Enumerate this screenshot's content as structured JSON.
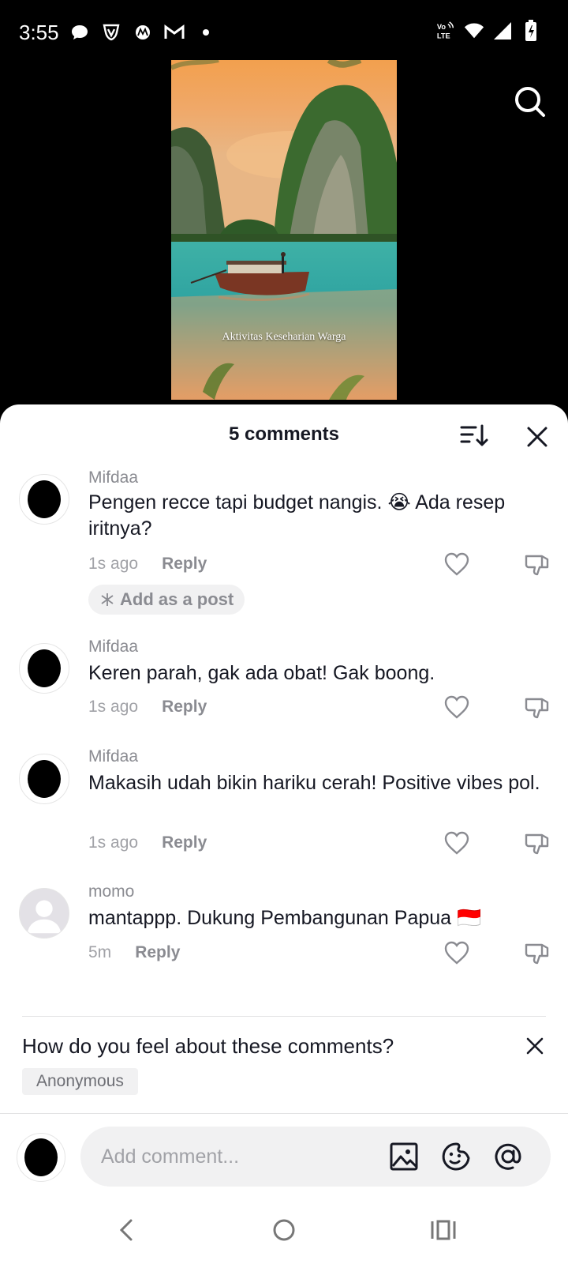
{
  "status_bar": {
    "time": "3:55",
    "left_icons": [
      "message-bubble-icon",
      "shield-v-icon",
      "motorola-icon",
      "gmail-icon",
      "dot-icon"
    ],
    "right_icons": [
      "volte-icon",
      "wifi-icon",
      "signal-icon",
      "battery-charging-icon"
    ],
    "volte_label_top": "Vo",
    "volte_label_bottom": "LTE"
  },
  "video": {
    "caption": "Aktivitas Keseharian Warga"
  },
  "comments_panel": {
    "title": "5 comments",
    "comments": [
      {
        "username": "Mifdaa",
        "text": "Pengen recce tapi budget nangis. 😭 Ada resep iritnya?",
        "time": "1s ago",
        "reply_label": "Reply",
        "add_post_label": "Add as a post"
      },
      {
        "username": "Mifdaa",
        "text": "Keren parah, gak ada obat! Gak boong.",
        "time": "1s ago",
        "reply_label": "Reply"
      },
      {
        "username": "Mifdaa",
        "text": "Makasih udah bikin hariku cerah! Positive vibes pol.",
        "time": "1s ago",
        "reply_label": "Reply"
      },
      {
        "username": "momo",
        "text": "mantappp. Dukung Pembangunan Papua 🇮🇩",
        "time": "5m",
        "reply_label": "Reply"
      }
    ],
    "feedback": {
      "question": "How do you feel about these comments?",
      "tag": "Anonymous"
    },
    "input": {
      "placeholder": "Add comment..."
    }
  },
  "colors": {
    "text_primary": "#161823",
    "text_secondary": "#8a8b91",
    "surface": "#f1f1f2",
    "flag_red": "#e4202c"
  }
}
